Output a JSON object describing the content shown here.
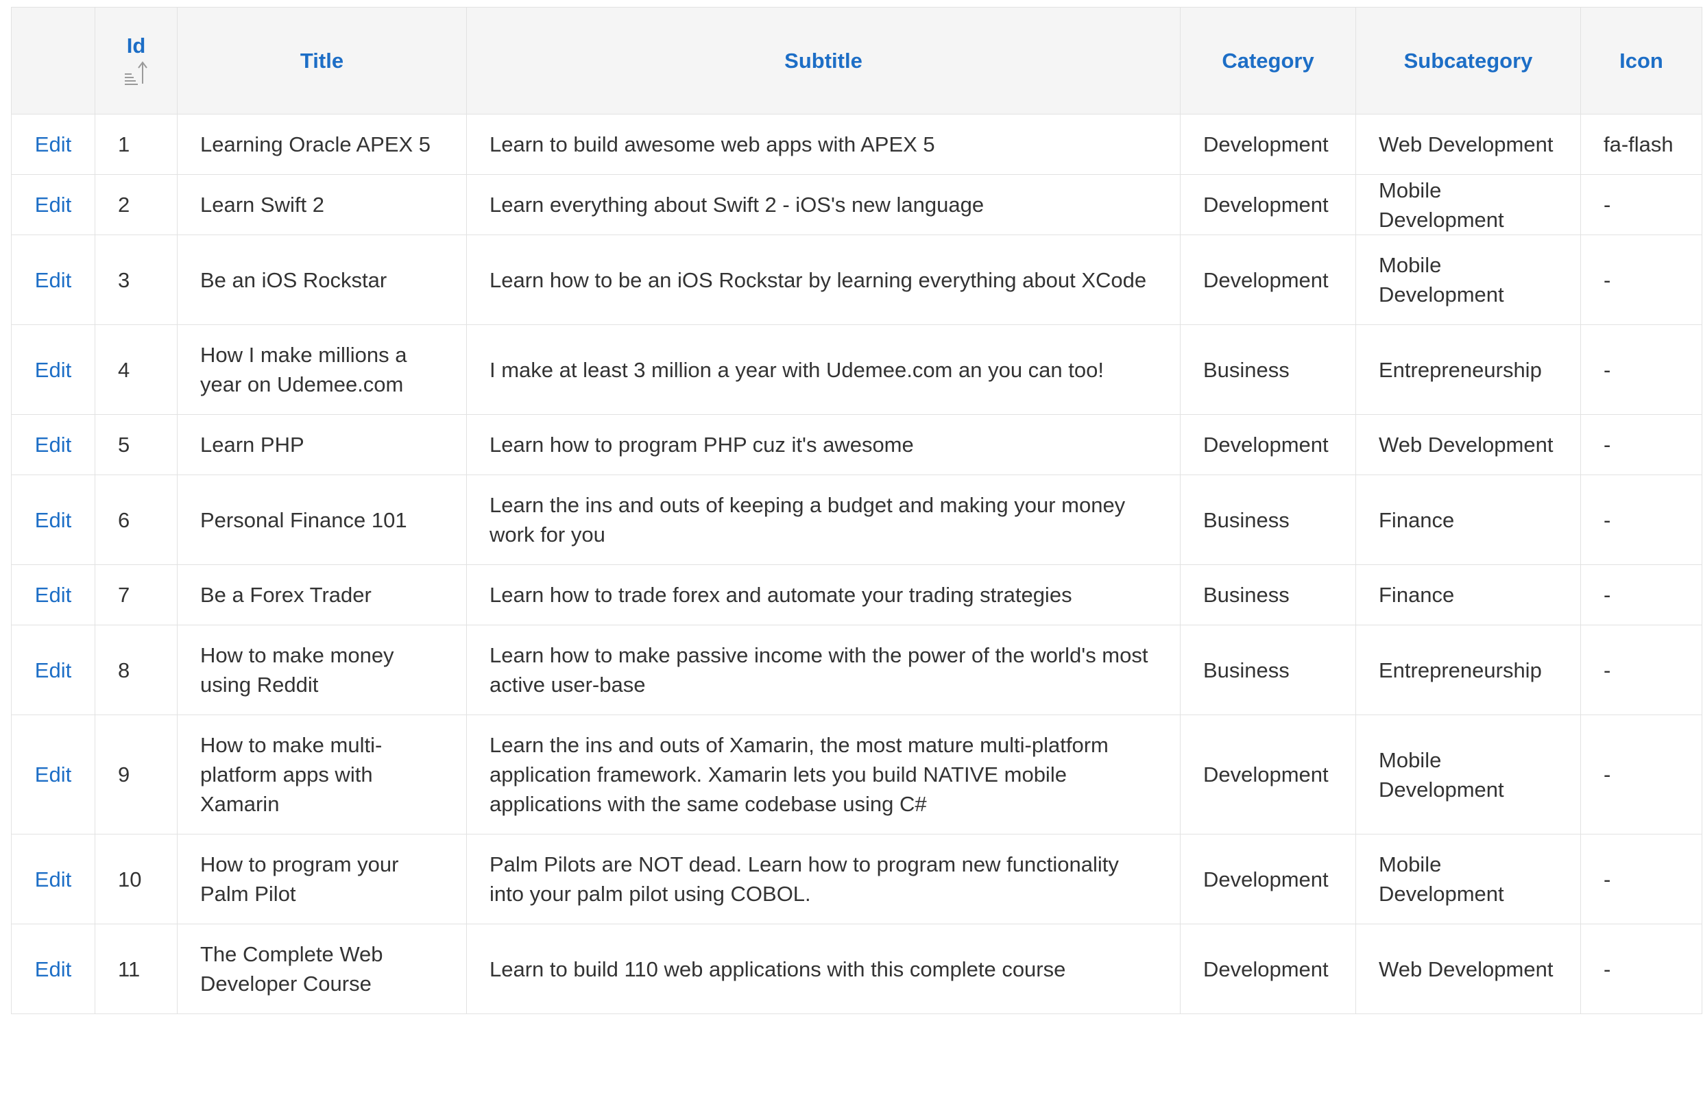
{
  "report": {
    "columns": {
      "edit": "",
      "id": "Id",
      "title": "Title",
      "subtitle": "Subtitle",
      "category": "Category",
      "subcategory": "Subcategory",
      "icon": "Icon"
    },
    "sort": {
      "column": "Id",
      "direction": "ascending",
      "icon": "sort-ascending-icon"
    },
    "rows": [
      {
        "edit": "Edit",
        "id": "1",
        "title": "Learning Oracle APEX 5",
        "subtitle": "Learn to build awesome web apps with APEX 5",
        "category": "Development",
        "subcategory": "Web Development",
        "icon": "fa-flash"
      },
      {
        "edit": "Edit",
        "id": "2",
        "title": "Learn Swift 2",
        "subtitle": "Learn everything about Swift 2 - iOS's new language",
        "category": "Development",
        "subcategory": "Mobile Development",
        "icon": "-"
      },
      {
        "edit": "Edit",
        "id": "3",
        "title": "Be an iOS Rockstar",
        "subtitle": "Learn how to be an iOS Rockstar by learning everything about XCode",
        "category": "Development",
        "subcategory": "Mobile Development",
        "icon": "-"
      },
      {
        "edit": "Edit",
        "id": "4",
        "title": "How I make millions a year on Udemee.com",
        "subtitle": "I make at least 3 million a year with Udemee.com an you can too!",
        "category": "Business",
        "subcategory": "Entrepreneurship",
        "icon": "-"
      },
      {
        "edit": "Edit",
        "id": "5",
        "title": "Learn PHP",
        "subtitle": "Learn how to program PHP cuz it's awesome",
        "category": "Development",
        "subcategory": "Web Development",
        "icon": "-"
      },
      {
        "edit": "Edit",
        "id": "6",
        "title": "Personal Finance 101",
        "subtitle": "Learn the ins and outs of keeping a budget and making your money work for you",
        "category": "Business",
        "subcategory": "Finance",
        "icon": "-"
      },
      {
        "edit": "Edit",
        "id": "7",
        "title": "Be a Forex Trader",
        "subtitle": "Learn how to trade forex and automate your trading strategies",
        "category": "Business",
        "subcategory": "Finance",
        "icon": "-"
      },
      {
        "edit": "Edit",
        "id": "8",
        "title": "How to make money using Reddit",
        "subtitle": "Learn how to make passive income with the power of the world's most active user-base",
        "category": "Business",
        "subcategory": "Entrepreneurship",
        "icon": "-"
      },
      {
        "edit": "Edit",
        "id": "9",
        "title": "How to make multi-platform apps with Xamarin",
        "subtitle": "Learn the ins and outs of Xamarin, the most mature multi-platform application framework. Xamarin lets you build NATIVE mobile applications with the same codebase using C#",
        "category": "Development",
        "subcategory": "Mobile Development",
        "icon": "-"
      },
      {
        "edit": "Edit",
        "id": "10",
        "title": "How to program your Palm Pilot",
        "subtitle": "Palm Pilots are NOT dead. Learn how to program new functionality into your palm pilot using COBOL.",
        "category": "Development",
        "subcategory": "Mobile Development",
        "icon": "-"
      },
      {
        "edit": "Edit",
        "id": "11",
        "title": "The Complete Web Developer Course",
        "subtitle": "Learn to build 110 web applications with this complete course",
        "category": "Development",
        "subcategory": "Web Development",
        "icon": "-"
      }
    ]
  }
}
